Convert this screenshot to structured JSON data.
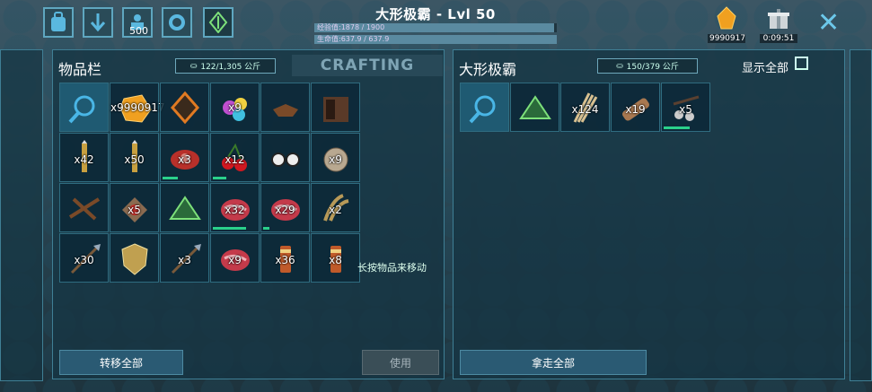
{
  "header": {
    "title": "大形极霸 - Lvl 50",
    "xp_label": "经验值:1878 / 1900",
    "xp_fraction": 0.988,
    "health_label": "生命值:637.9 / 637.9",
    "health_fraction": 1.0,
    "count_badge": "500",
    "ember_value": "9990917",
    "timer_value": "0:09:51",
    "close_label": "✕"
  },
  "inventory": {
    "title": "物品栏",
    "weight": "122/1,305 公斤",
    "crafting_tab": "CRAFTING",
    "move_hint": "长按物品来移动",
    "transfer_all": "转移全部",
    "use": "使用",
    "slots": [
      {
        "icon": "search-icon",
        "qty": ""
      },
      {
        "icon": "amber-icon",
        "qty": "x9990917",
        "top": true
      },
      {
        "icon": "element-icon",
        "qty": ""
      },
      {
        "icon": "candy-icon",
        "qty": "x9",
        "top": true
      },
      {
        "icon": "saddle-icon",
        "qty": ""
      },
      {
        "icon": "cabinet-icon",
        "qty": ""
      },
      {
        "icon": "dart-icon",
        "qty": "x42"
      },
      {
        "icon": "dart-icon",
        "qty": "x50"
      },
      {
        "icon": "meat-icon",
        "qty": "x3",
        "dur": 0.35
      },
      {
        "icon": "berry-icon",
        "qty": "x12",
        "dur": 0.3
      },
      {
        "icon": "glasses-icon",
        "qty": ""
      },
      {
        "icon": "egg-icon",
        "qty": "x9"
      },
      {
        "icon": "crossbow-icon",
        "qty": ""
      },
      {
        "icon": "kibble-icon",
        "qty": "x5"
      },
      {
        "icon": "green-triangle-icon",
        "qty": ""
      },
      {
        "icon": "steak-icon",
        "qty": "x32",
        "dur": 0.75
      },
      {
        "icon": "steak-icon",
        "qty": "x29",
        "dur": 0.15
      },
      {
        "icon": "claw-icon",
        "qty": "x2"
      },
      {
        "icon": "spear-icon",
        "qty": "x30"
      },
      {
        "icon": "shield-icon",
        "qty": ""
      },
      {
        "icon": "spear-icon",
        "qty": "x3"
      },
      {
        "icon": "steak-icon",
        "qty": "x9"
      },
      {
        "icon": "flare-icon",
        "qty": "x36"
      },
      {
        "icon": "flare-icon",
        "qty": "x8"
      }
    ]
  },
  "creature": {
    "title": "大形极霸",
    "weight": "150/379 公斤",
    "show_all": "显示全部",
    "take_all": "拿走全部",
    "slots": [
      {
        "icon": "search-icon",
        "qty": ""
      },
      {
        "icon": "green-triangle-icon",
        "qty": ""
      },
      {
        "icon": "thatch-icon",
        "qty": "x124"
      },
      {
        "icon": "wood-icon",
        "qty": "x19"
      },
      {
        "icon": "bola-icon",
        "qty": "x5",
        "dur": 0.6
      }
    ]
  },
  "colors": {
    "accent": "#5fa7c0",
    "durability": "#2ad08b",
    "panel": "#16344233"
  }
}
